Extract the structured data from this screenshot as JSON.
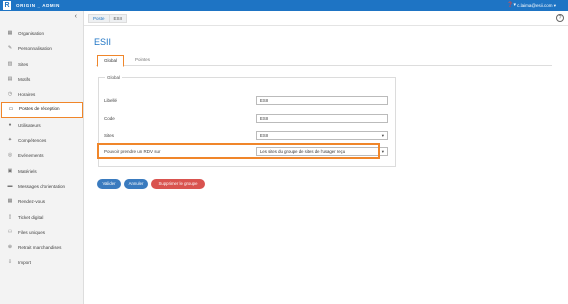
{
  "app": {
    "logo_letter": "R",
    "brand": "ORIGIN _ ADMIN",
    "help": "❓▾",
    "user": "c.laima@esii.com ▾"
  },
  "sidebar": {
    "collapse": "‹",
    "items": [
      {
        "icon": "building-icon",
        "glyph": "▦",
        "label": "Organisation"
      },
      {
        "icon": "brush-icon",
        "glyph": "✎",
        "label": "Personnalisation"
      },
      {
        "icon": "sites-icon",
        "glyph": "▥",
        "label": "Sites"
      },
      {
        "icon": "reasons-icon",
        "glyph": "▤",
        "label": "Motifs"
      },
      {
        "icon": "clock-icon",
        "glyph": "◷",
        "label": "Horaires"
      },
      {
        "icon": "monitor-icon",
        "glyph": "▭",
        "label": "Postes de réception"
      },
      {
        "icon": "user-icon",
        "glyph": "●",
        "label": "Utilisateurs"
      },
      {
        "icon": "skills-icon",
        "glyph": "✦",
        "label": "Compétences"
      },
      {
        "icon": "events-icon",
        "glyph": "◎",
        "label": "Evénements"
      },
      {
        "icon": "hardware-icon",
        "glyph": "▣",
        "label": "Matériels"
      },
      {
        "icon": "message-icon",
        "glyph": "▬",
        "label": "Messages d'orientation"
      },
      {
        "icon": "calendar-icon",
        "glyph": "▦",
        "label": "Rendez-vous"
      },
      {
        "icon": "ticket-icon",
        "glyph": "▯",
        "label": "Ticket digital"
      },
      {
        "icon": "queue-icon",
        "glyph": "⚇",
        "label": "Files uniques"
      },
      {
        "icon": "pickup-icon",
        "glyph": "⊕",
        "label": "Retrait marchandises"
      },
      {
        "icon": "import-icon",
        "glyph": "⇩",
        "label": "Import"
      }
    ]
  },
  "breadcrumb": {
    "root": "Poste",
    "current": "ESII"
  },
  "help_circle": "?",
  "page_title": "ESII",
  "tabs": {
    "global": "Global",
    "pointers": "Pointes"
  },
  "form": {
    "legend": "Global",
    "label_libelle": "Libellé",
    "value_libelle": "ESII",
    "label_code": "Code",
    "value_code": "ESII",
    "label_sites": "Sites",
    "value_sites": "ESII",
    "label_rdv": "Pouvoir prendre un RDV sur",
    "value_rdv": "Les sites du groupe de sites de l'usager reçu",
    "caret": "▾"
  },
  "buttons": {
    "save": "Valider",
    "cancel": "Annuler",
    "delete": "Supprimer le groupe"
  },
  "colors": {
    "header": "#1e74c4",
    "highlight": "#f0862a",
    "primary_button": "#3a7bbf",
    "danger_button": "#d9534f"
  }
}
